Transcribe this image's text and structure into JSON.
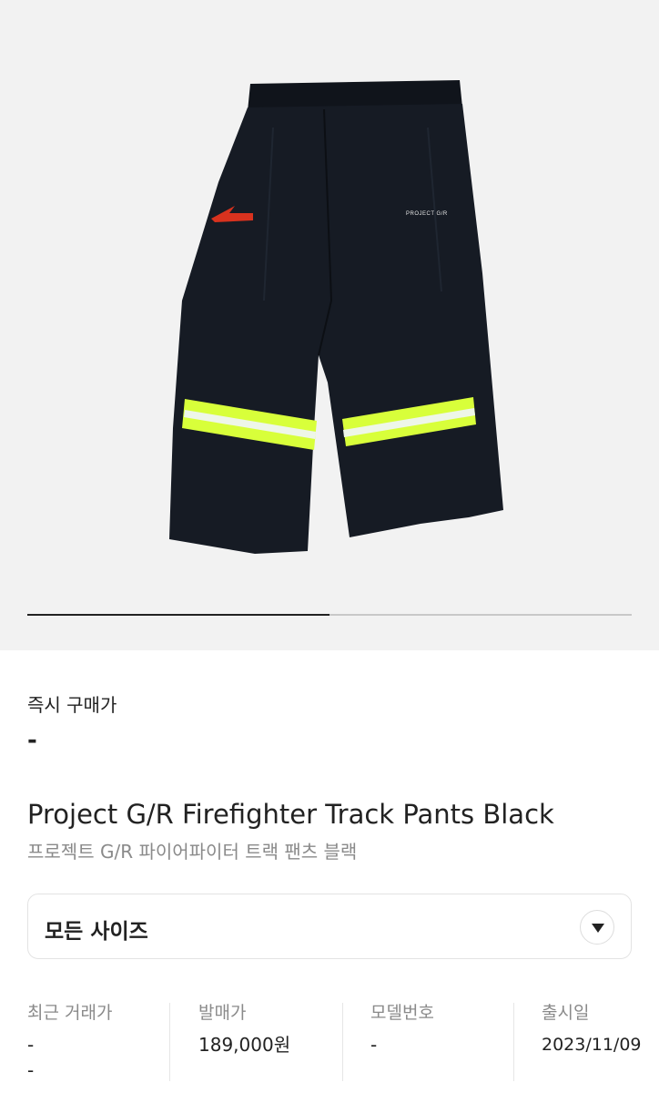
{
  "gallery": {
    "progress_fraction": 0.5,
    "image_alt": "Project G/R Firefighter Track Pants Black",
    "brand_print": "PROJECT G/R"
  },
  "price": {
    "label": "즉시 구매가",
    "value": "-"
  },
  "product": {
    "title_en": "Project G/R Firefighter Track Pants Black",
    "title_ko": "프로젝트 G/R 파이어파이터 트랙 팬츠 블랙"
  },
  "size_selector": {
    "label": "모든 사이즈",
    "icon": "chevron-down-icon"
  },
  "stats": [
    {
      "label": "최근 거래가",
      "value": "-",
      "value2": "-"
    },
    {
      "label": "발매가",
      "value": "189,000원"
    },
    {
      "label": "모델번호",
      "value": "-"
    },
    {
      "label": "출시일",
      "value": "2023/11/09"
    }
  ],
  "colors": {
    "accent_reflective": "#d8ff3a",
    "pants": "#151a22",
    "logo_red": "#d8321e"
  }
}
